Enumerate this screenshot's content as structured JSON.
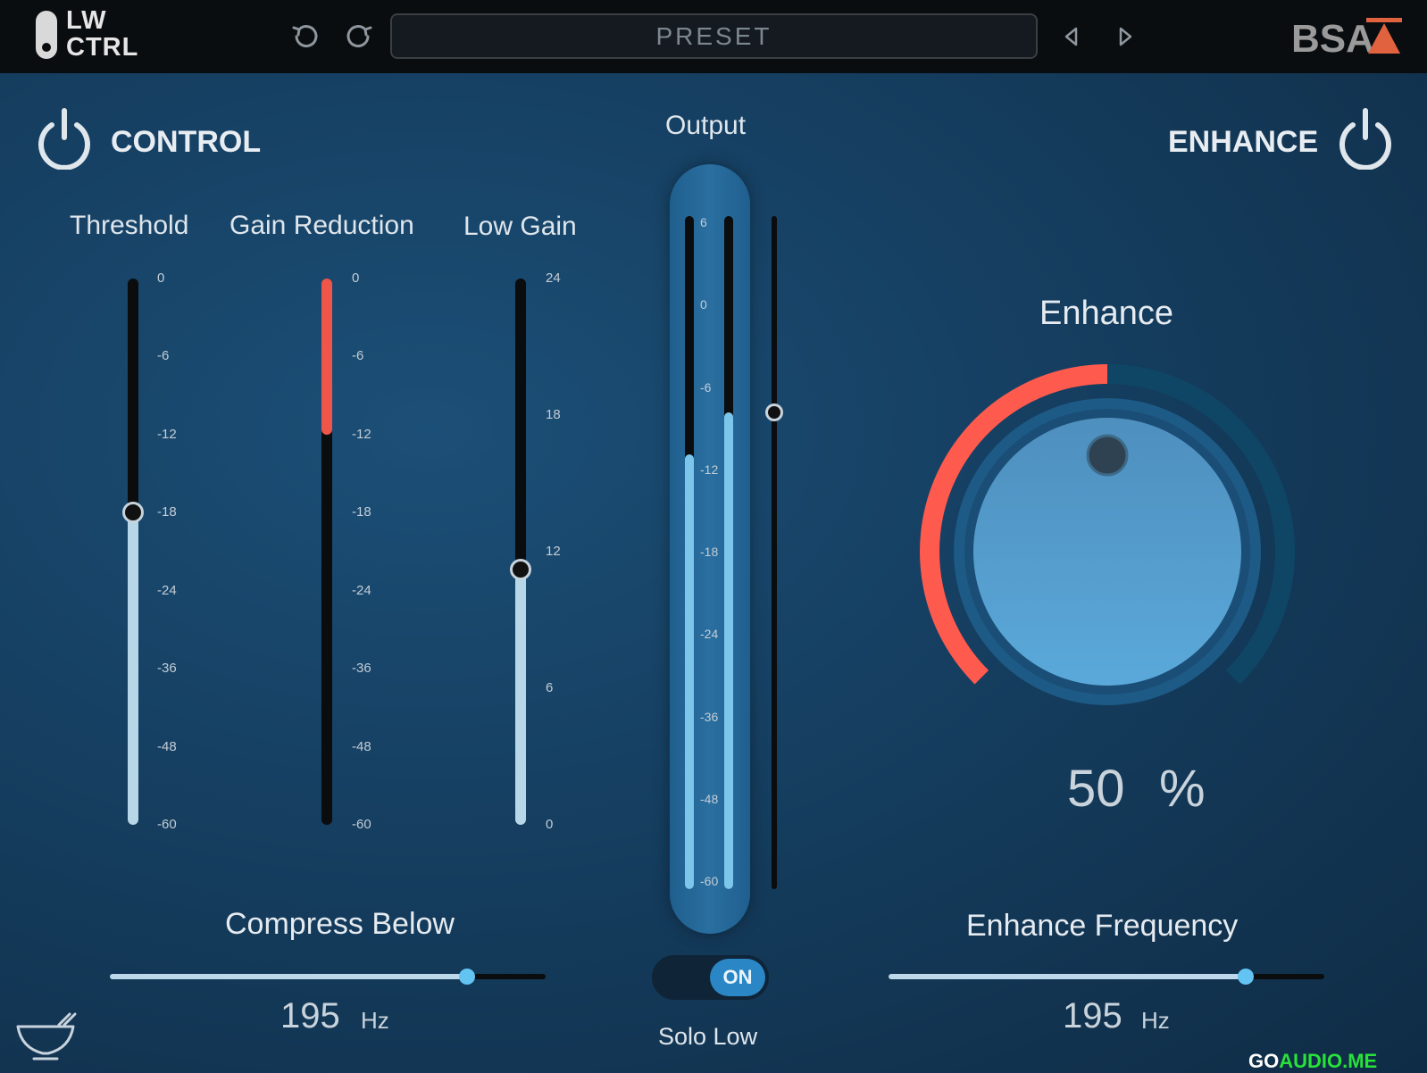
{
  "header": {
    "logo_line1": "LW",
    "logo_line2": "CTRL",
    "preset_label": "PRESET",
    "brand": "BSA"
  },
  "control": {
    "title": "CONTROL",
    "threshold": {
      "label": "Threshold",
      "ticks": [
        "0",
        "-6",
        "-12",
        "-18",
        "-24",
        "-36",
        "-48",
        "-60"
      ],
      "value_db": -18
    },
    "gain_reduction": {
      "label": "Gain Reduction",
      "ticks": [
        "0",
        "-6",
        "-12",
        "-18",
        "-24",
        "-36",
        "-48",
        "-60"
      ],
      "value_db": -12
    },
    "low_gain": {
      "label": "Low Gain",
      "ticks": [
        "24",
        "18",
        "12",
        "6",
        "0"
      ],
      "value_db": 11.2
    },
    "compress_below": {
      "label": "Compress Below",
      "value": "195",
      "unit": "Hz",
      "slider_fraction": 0.82
    }
  },
  "output": {
    "label": "Output",
    "ticks": [
      "6",
      "0",
      "-6",
      "-12",
      "-18",
      "-24",
      "-36",
      "-48",
      "-60"
    ],
    "meter_left_db": -11,
    "meter_right_db": -8,
    "fader_db": -8,
    "solo": {
      "label": "Solo Low",
      "state": "ON"
    }
  },
  "enhance": {
    "title": "ENHANCE",
    "knob_label": "Enhance",
    "value": "50",
    "unit": "%",
    "value_fraction": 0.5,
    "frequency": {
      "label": "Enhance Frequency",
      "value": "195",
      "unit": "Hz",
      "slider_fraction": 0.82
    }
  },
  "footer": {
    "watermark_left": "GO",
    "watermark_right": "AUDIO.ME"
  },
  "colors": {
    "accent_red": "#ff5a4e",
    "accent_blue": "#63c4f2",
    "fill_light_blue": "#bcd8ea",
    "knob_blue": "#4e9bcb",
    "ring_dark": "#0f4665"
  },
  "icons": [
    "power-icon",
    "undo-icon",
    "redo-icon",
    "prev-preset-icon",
    "next-preset-icon",
    "bowl-icon"
  ]
}
